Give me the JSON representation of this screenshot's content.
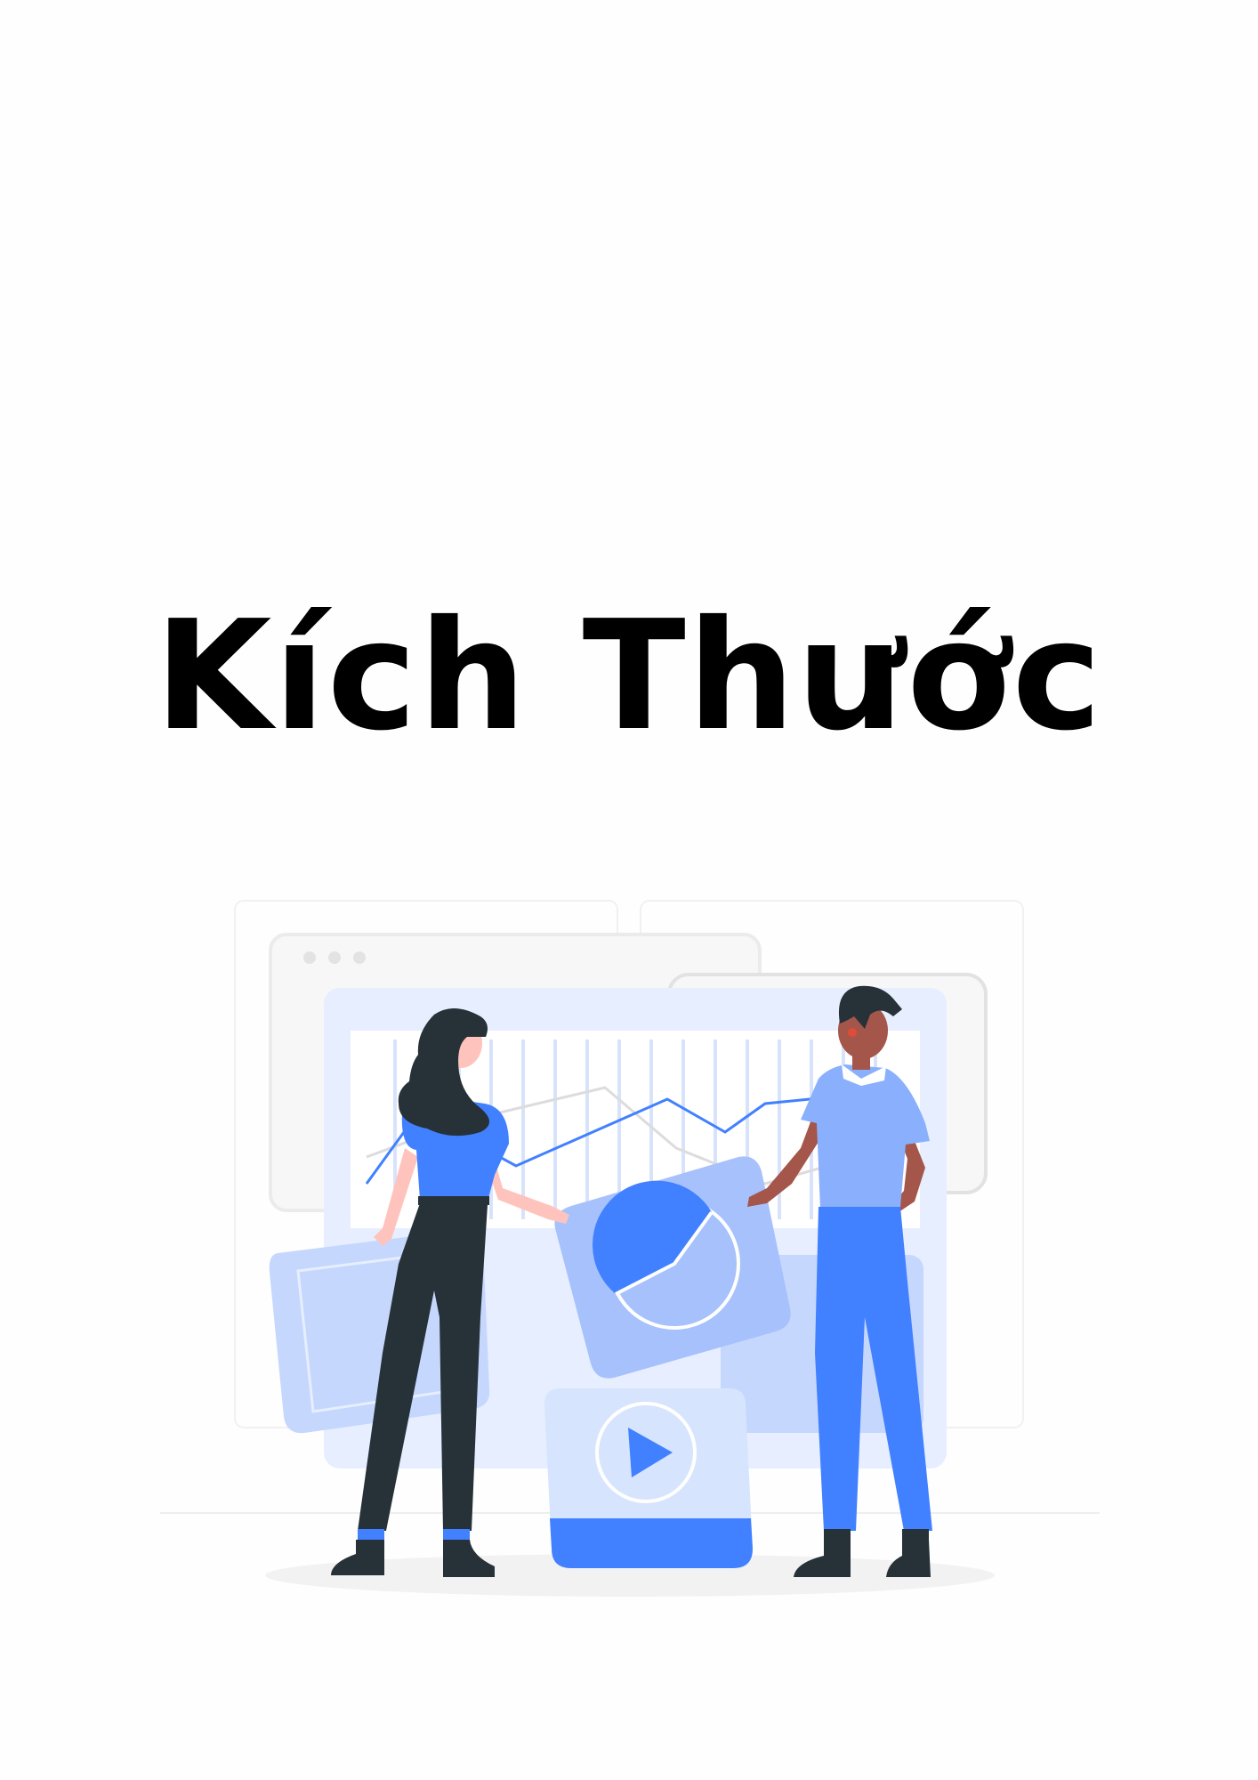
{
  "page": {
    "title": "Kích Thước"
  },
  "illustration": {
    "subject": "people-with-charts-illustration",
    "colors": {
      "accent_blue": "#4180ff",
      "light_blue": "#a6c1fb",
      "pale_blue": "#e6eeff",
      "dark_navy": "#263238",
      "skin_light": "#ffc3bd",
      "skin_dark": "#a4564b",
      "shirt_light_blue": "#8ab0fd",
      "panel_grey": "#f5f5f5"
    }
  }
}
